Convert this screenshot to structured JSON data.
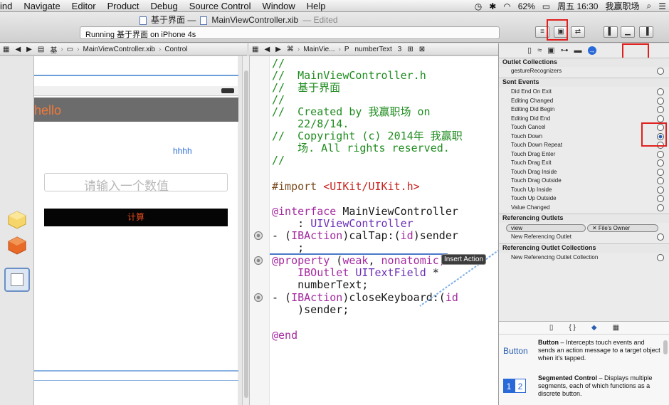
{
  "menubar": {
    "items": [
      "ind",
      "Navigate",
      "Editor",
      "Product",
      "Debug",
      "Source Control",
      "Window",
      "Help"
    ],
    "battery": "62%",
    "datetime": "周五 16:30",
    "user": "我赢职场"
  },
  "window": {
    "project": "基于界面 —",
    "file": "MainViewController.xib",
    "edited": "— Edited",
    "status": "Running 基于界面 on iPhone 4s"
  },
  "left_jump": [
    "基",
    "MainViewController.xib",
    "Control"
  ],
  "code_jump": [
    "MainVie...",
    "numberText",
    "3"
  ],
  "canvas": {
    "nav_title": "hello",
    "label": "hhhh",
    "placeholder": "请输入一个数值",
    "button": "计算"
  },
  "code_lines": [
    {
      "cls": "cm",
      "text": "//"
    },
    {
      "cls": "cm",
      "text": "//  MainViewController.h"
    },
    {
      "cls": "cm",
      "text": "//  基于界面"
    },
    {
      "cls": "cm",
      "text": "//"
    },
    {
      "cls": "cm",
      "text": "//  Created by 我赢职场 on"
    },
    {
      "cls": "cm",
      "text": "    22/8/14."
    },
    {
      "cls": "cm",
      "text": "//  Copyright (c) 2014年 我赢职"
    },
    {
      "cls": "cm",
      "text": "    场. All rights reserved."
    },
    {
      "cls": "cm",
      "text": "//"
    }
  ],
  "code": {
    "import_kw": "#import",
    "import_str": "<UIKit/UIKit.h>",
    "interface_kw": "@interface",
    "interface_name": " MainViewController",
    "superclass_colon": "    : ",
    "superclass": "UIViewController",
    "m1_a": "- (",
    "m1_kw": "IBAction",
    "m1_b": ")calTap:(",
    "m1_id": "id",
    "m1_c": ")sender",
    "m1_d": "    ;",
    "prop_kw": "@property",
    "prop_a": " (",
    "prop_weak": "weak",
    "prop_b": ", ",
    "prop_nonatomic": "nonatomic)",
    "prop_c": "    ",
    "prop_outlet": "IBOutlet",
    "prop_d": " ",
    "prop_type": "UITextField",
    "prop_e": " *",
    "prop_f": "    numberText;",
    "m2_a": "- (",
    "m2_kw": "IBAction",
    "m2_b": ")closeKeyboard:(",
    "m2_id": "id",
    "m2_c": "    )sender;",
    "end": "@end"
  },
  "tooltip": "Insert Action",
  "inspector": {
    "outlet_collections_title": "Outlet Collections",
    "gesture": "gestureRecognizers",
    "sent_events_title": "Sent Events",
    "events": [
      "Did End On Exit",
      "Editing Changed",
      "Editing Did Begin",
      "Editing Did End",
      "Touch Cancel",
      "Touch Down",
      "Touch Down Repeat",
      "Touch Drag Enter",
      "Touch Drag Exit",
      "Touch Drag Inside",
      "Touch Drag Outside",
      "Touch Up Inside",
      "Touch Up Outside",
      "Value Changed"
    ],
    "ref_outlets_title": "Referencing Outlets",
    "ref_view": "view",
    "ref_owner": "✕ File's Owner",
    "new_ref_outlet": "New Referencing Outlet",
    "ref_collections_title": "Referencing Outlet Collections",
    "new_ref_collection": "New Referencing Outlet Collection"
  },
  "library": {
    "tabs": [
      "{ }"
    ],
    "button_icon_label": "Button",
    "button_title": "Button",
    "button_desc": " – Intercepts touch events and sends an action message to a target object when it's tapped.",
    "seg_title": "Segmented Control",
    "seg_desc": " – Displays multiple segments, each of which functions as a discrete button.",
    "seg_1": "1",
    "seg_2": "2"
  },
  "colors": {
    "accent": "#2a5fb0",
    "highlight": "#e0201e",
    "comment": "#1f8c1f",
    "keyword": "#a52aa0"
  }
}
